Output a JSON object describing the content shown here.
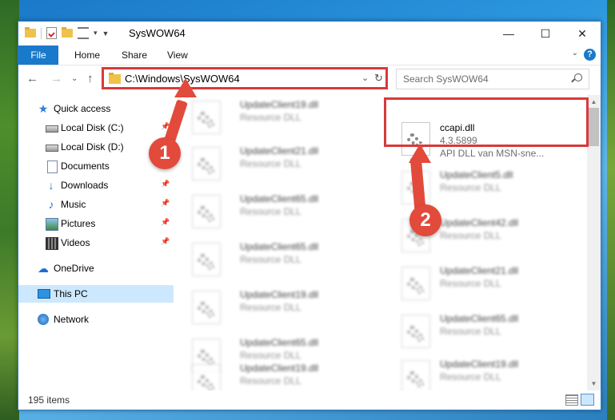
{
  "window": {
    "title": "SysWOW64",
    "controls": {
      "minimize": "—",
      "maximize": "☐",
      "close": "✕"
    }
  },
  "ribbon": {
    "file_tab": "File",
    "tabs": [
      "Home",
      "Share",
      "View"
    ],
    "help_label": "?"
  },
  "address_bar": {
    "path": "C:\\Windows\\SysWOW64"
  },
  "search": {
    "placeholder": "Search SysWOW64"
  },
  "nav_pane": {
    "items": [
      {
        "label": "Quick access",
        "icon": "star-icon"
      },
      {
        "label": "Local Disk (C:)",
        "icon": "disk-icon",
        "pinned": true
      },
      {
        "label": "Local Disk (D:)",
        "icon": "disk-icon",
        "pinned": false
      },
      {
        "label": "Documents",
        "icon": "documents-icon",
        "pinned": true
      },
      {
        "label": "Downloads",
        "icon": "downloads-icon",
        "pinned": true
      },
      {
        "label": "Music",
        "icon": "music-icon",
        "pinned": true
      },
      {
        "label": "Pictures",
        "icon": "pictures-icon",
        "pinned": true
      },
      {
        "label": "Videos",
        "icon": "videos-icon",
        "pinned": true
      },
      {
        "label": "OneDrive",
        "icon": "onedrive-icon"
      },
      {
        "label": "This PC",
        "icon": "this-pc-icon",
        "selected": true
      },
      {
        "label": "Network",
        "icon": "network-icon"
      }
    ]
  },
  "files": {
    "highlighted": {
      "name": "ccapi.dll",
      "version": "4.3.5899",
      "description": "API DLL van MSN-sne..."
    },
    "left_column": [
      {
        "name": "UpdateClient19.dll",
        "type": "Resource DLL"
      },
      {
        "name": "UpdateClient21.dll",
        "type": "Resource DLL"
      },
      {
        "name": "UpdateClient65.dll",
        "type": "Resource DLL"
      },
      {
        "name": "UpdateClient65.dll",
        "type": "Resource DLL"
      },
      {
        "name": "UpdateClient19.dll",
        "type": "Resource DLL"
      },
      {
        "name": "UpdateClient65.dll",
        "type": "Resource DLL"
      },
      {
        "name": "UpdateClient19.dll",
        "type": "Resource DLL"
      }
    ],
    "right_column": [
      {
        "name": "UpdateClient5.dll",
        "type": "Resource DLL"
      },
      {
        "name": "UpdateClient42.dll",
        "type": "Resource DLL"
      },
      {
        "name": "UpdateClient21.dll",
        "type": "Resource DLL"
      },
      {
        "name": "UpdateClient65.dll",
        "type": "Resource DLL"
      },
      {
        "name": "UpdateClient19.dll",
        "type": "Resource DLL"
      }
    ]
  },
  "status_bar": {
    "item_count": "195 items"
  },
  "annotations": {
    "marker_1": "1",
    "marker_2": "2",
    "color": "#e24a3b",
    "highlight_color": "#d9393b"
  },
  "colors": {
    "file_tab": "#1979ca",
    "selected_item": "#cce8ff"
  }
}
